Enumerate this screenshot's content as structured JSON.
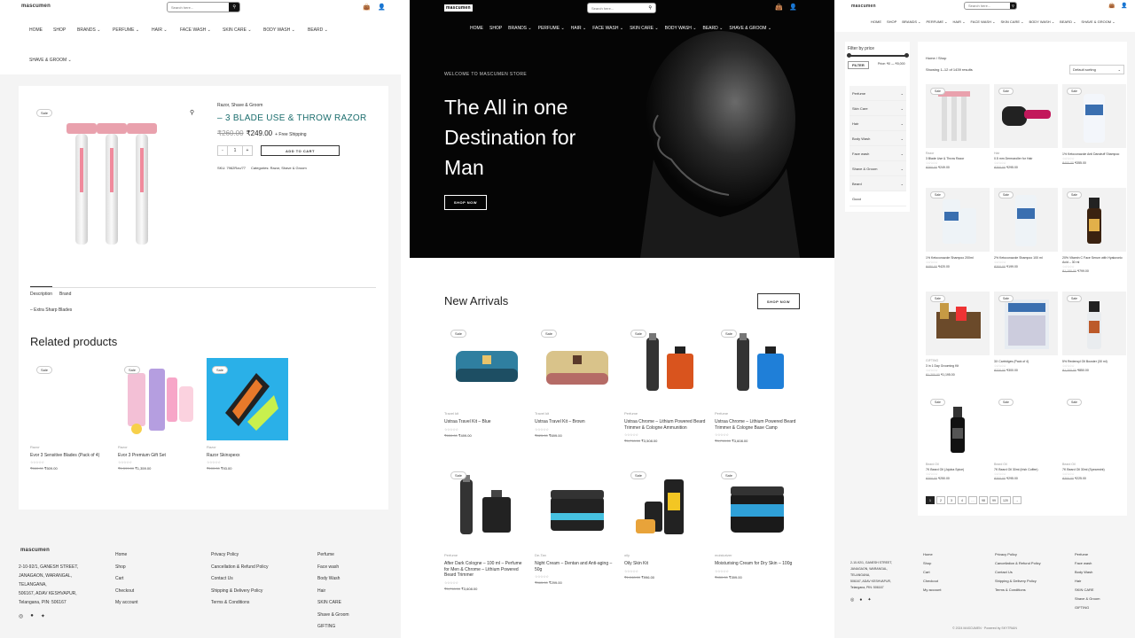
{
  "p1": {
    "logo": "mascumen",
    "search_placeholder": "Search here...",
    "cart_count": "0",
    "nav": [
      "HOME",
      "SHOP",
      "BRANDS",
      "PERFUME",
      "HAIR",
      "FACE WASH",
      "SKIN CARE",
      "BODY WASH",
      "BEARD"
    ],
    "nav2": "SHAVE & GROOM",
    "product": {
      "category": "Razor, Shave & Groom",
      "title": "– 3 BLADE USE & THROW RAZOR",
      "old_price": "₹260.00",
      "price": "₹249.00",
      "shipping": "+ Free Shipping",
      "qty": "1",
      "add_to_cart": "ADD TO CART",
      "sku": "SKU: 7962Rzo/77",
      "categories": "Categories: Razor, Shave & Groom",
      "sale": "Sale"
    },
    "tabs": [
      "Description",
      "Brand"
    ],
    "description": "– Extra Sharp Blades",
    "related_title": "Related products",
    "related": [
      {
        "cat": "Razor",
        "name": "Evor 3 Sensitive Blades (Pack of 4)",
        "old": "₹660.00",
        "price": "₹509.00"
      },
      {
        "cat": "Razor",
        "name": "Evor 3 Premium Gift Set",
        "old": "₹1,599.00",
        "price": "₹1,359.00"
      },
      {
        "cat": "Razor",
        "name": "Razor Skinspexx",
        "old": "₹100.00",
        "price": "₹93.00"
      }
    ],
    "footer": {
      "logo": "mascumen",
      "address": [
        "2-10-92/1, GANESH STREET,",
        "JANAGAON, WARANGAL,",
        "TELANGANA,",
        "506167, ADAV KESHVAPUR,",
        "Telangana, PIN: 506167"
      ],
      "col1": [
        "Home",
        "Shop",
        "Cart",
        "Checkout",
        "My account"
      ],
      "col2": [
        "Privacy Policy",
        "Cancellation & Refund Policy",
        "Contact Us",
        "Shipping & Delivery Policy",
        "Terms & Conditions"
      ],
      "col3": [
        "Perfume",
        "Face wash",
        "Body Wash",
        "Hair",
        "SKIN CARE",
        "Shave & Groom",
        "GIFTING"
      ]
    }
  },
  "p2": {
    "logo": "mascumen",
    "search_placeholder": "Search here...",
    "cart_count": "0",
    "nav": [
      "HOME",
      "SHOP",
      "BRANDS",
      "PERFUME",
      "HAIR",
      "FACE WASH",
      "SKIN CARE",
      "BODY WASH",
      "BEARD",
      "SHAVE & GROOM"
    ],
    "hero": {
      "eyebrow": "WELCOME TO MASCUMEN STORE",
      "line1": "The All in one",
      "line2": "Destination for",
      "line3": "Man",
      "cta": "SHOP NOW"
    },
    "new_title": "New Arrivals",
    "shop_now": "SHOP NOW",
    "products": [
      {
        "cat": "Travel kit",
        "name": "Ustraa Travel Kit – Blue",
        "old": "₹650.00",
        "price": "₹499.00",
        "sale": "Sale"
      },
      {
        "cat": "Travel kit",
        "name": "Ustraa Travel Kit – Brown",
        "old": "₹825.00",
        "price": "₹699.00",
        "sale": "Sale"
      },
      {
        "cat": "Perfume",
        "name": "Ustraa Chrome – Lithium Powered Beard Trimmer & Cologne Ammunition",
        "old": "₹3,798.00",
        "price": "₹3,508.00",
        "sale": "Sale"
      },
      {
        "cat": "Perfume",
        "name": "Ustraa Chrome – Lithium Powered Beard Trimmer & Cologne Base Camp",
        "old": "₹3,798.00",
        "price": "₹3,608.00",
        "sale": "Sale"
      },
      {
        "cat": "Perfume",
        "name": "After Dark Cologne – 100 ml – Perfume for Men & Chrome – Lithium Powered Beard Trimmer",
        "old": "₹3,798.00",
        "price": "₹3,608.00",
        "sale": "Sale"
      },
      {
        "cat": "De-Tan",
        "name": "Night Cream – Dentan and Anti-aging – 50g",
        "old": "₹365.00",
        "price": "₹299.00",
        "sale": ""
      },
      {
        "cat": "oily",
        "name": "Oily Skin Kit",
        "old": "₹1,048.00",
        "price": "₹996.00",
        "sale": "Sale"
      },
      {
        "cat": "moisturizer",
        "name": "Moisturising Cream for Dry Skin – 100g",
        "old": "₹450.00",
        "price": "₹399.00",
        "sale": "Sale"
      }
    ]
  },
  "p3": {
    "logo": "mascumen",
    "search_placeholder": "Search here...",
    "nav": [
      "HOME",
      "SHOP",
      "BRANDS",
      "PERFUME",
      "HAIR",
      "FACE WASH",
      "SKIN CARE",
      "BODY WASH",
      "BEARD",
      "SHAVE & GROOM"
    ],
    "filter_title": "Filter by price",
    "filter_btn": "FILTER",
    "price_range": "Price: ₹0 — ₹5,000",
    "categories": [
      "Perfume",
      "Skin Care",
      "Hair",
      "Body Wash",
      "Face wash",
      "Shave & Groom",
      "Beard",
      "Gucci"
    ],
    "breadcrumb": "Home / Shop",
    "results": "Showing 1–12 of 1439 results",
    "sorting": "Default sorting",
    "products": [
      {
        "cat": "Razor",
        "name": "3 Blade Use & Throw Razor",
        "old": "₹260.00",
        "price": "₹249.00"
      },
      {
        "cat": "Hair",
        "name": "0.5 mm Dermaroller for Hair",
        "old": "₹300.00",
        "price": "₹295.00"
      },
      {
        "cat": "",
        "name": "1% Ketoconazole Anti Dandruff Shampoo",
        "old": "₹400.00",
        "price": "₹355.00"
      },
      {
        "cat": "",
        "name": "1% Ketoconazole Shampoo 200ml",
        "old": "₹480.00",
        "price": "₹420.00"
      },
      {
        "cat": "",
        "name": "2% Ketoconazole Shampoo 100 ml",
        "old": "₹300.00",
        "price": "₹199.00"
      },
      {
        "cat": "",
        "name": "20% Vitamin C Face Serum with Hyaluronic Acid – 30 ml",
        "old": "₹1,150.00",
        "price": "₹799.00"
      },
      {
        "cat": "GIFTING",
        "name": "3 in 1 Day Grooming Kit",
        "old": "₹1,200.00",
        "price": "₹1,195.00"
      },
      {
        "cat": "",
        "name": "3X Cartridges (Pack of 4)",
        "old": "₹320.00",
        "price": "₹300.00"
      },
      {
        "cat": "",
        "name": "5% Redensyl Oil Booster (30 ml)",
        "old": "₹1,200.00",
        "price": "₹850.00"
      },
      {
        "cat": "Beard Oil",
        "name": "7K Beard Oil (Jojoba Spice)",
        "old": "₹300.00",
        "price": "₹250.00"
      },
      {
        "cat": "Beard Oil",
        "name": "7K Beard Oil 30ml (Irish Coffee)",
        "old": "₹300.00",
        "price": "₹295.00"
      },
      {
        "cat": "Beard Oil",
        "name": "7K Beard Oil 30ml (Spearmint)",
        "old": "₹300.00",
        "price": "₹225.00"
      }
    ],
    "pagination": [
      "1",
      "2",
      "3",
      "4",
      "…",
      "98",
      "99",
      "120",
      "→"
    ],
    "footer": {
      "address": [
        "2-10-92/1, GANESH STREET,",
        "JANAGAON, WARANGAL,",
        "TELANGANA,",
        "506167, ADAV KESHVAPUR,",
        "Telangana, PIN: 506167"
      ],
      "col1": [
        "Home",
        "Shop",
        "Cart",
        "Checkout",
        "My account"
      ],
      "col2": [
        "Privacy Policy",
        "Cancellation & Refund Policy",
        "Contact Us",
        "Shipping & Delivery Policy",
        "Terms & Conditions"
      ],
      "col3": [
        "Perfume",
        "Face wash",
        "Body Wash",
        "Hair",
        "SKIN CARE",
        "Shave & Groom",
        "GIFTING"
      ],
      "copyright": "© 2024 MASCUMEN · Powered by SKYTRAIN"
    }
  }
}
